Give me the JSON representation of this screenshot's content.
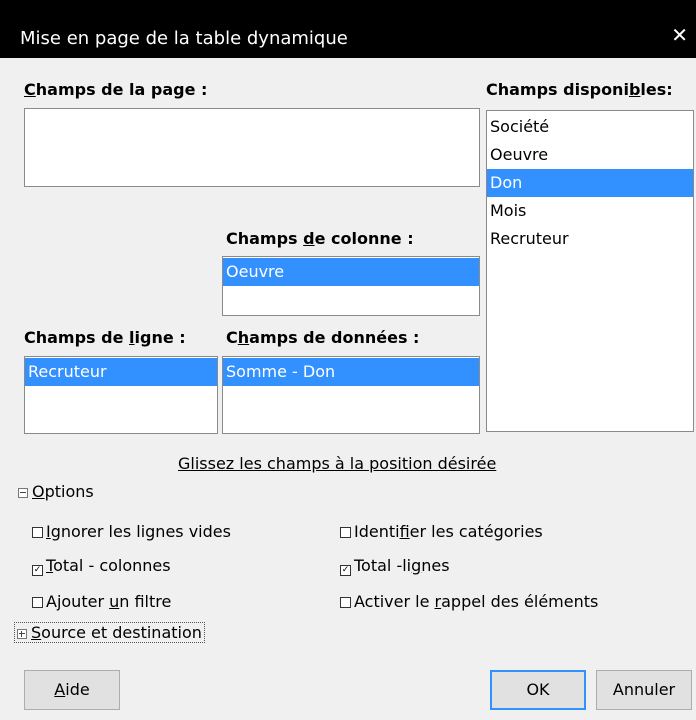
{
  "window": {
    "title": "Mise en page de la table dynamique",
    "close_glyph": "✕"
  },
  "page_fields": {
    "label": "Champs de la page :",
    "items": []
  },
  "available_fields": {
    "label": "Champs disponibles:",
    "items": [
      {
        "label": "Société",
        "selected": false
      },
      {
        "label": "Oeuvre",
        "selected": false
      },
      {
        "label": "Don",
        "selected": true
      },
      {
        "label": "Mois",
        "selected": false
      },
      {
        "label": "Recruteur",
        "selected": false
      }
    ]
  },
  "column_fields": {
    "label": "Champs de colonne :",
    "items": [
      {
        "label": "Oeuvre",
        "selected": true
      }
    ]
  },
  "row_fields": {
    "label": "Champs de ligne :",
    "items": [
      {
        "label": "Recruteur",
        "selected": true
      }
    ]
  },
  "data_fields": {
    "label": "Champs de données :",
    "items": [
      {
        "label": "Somme - Don",
        "selected": true
      }
    ]
  },
  "drag_hint": "Glissez les champs à la position désirée",
  "options": {
    "label": "Options",
    "expanded": true,
    "checkboxes": {
      "ignore_empty": {
        "label": "Ignorer les lignes vides",
        "checked": false
      },
      "identify_categories": {
        "label": "Identifier les catégories",
        "checked": false
      },
      "total_columns": {
        "label": "Total - colonnes",
        "checked": true
      },
      "total_rows": {
        "label": "Total -lignes",
        "checked": true
      },
      "add_filter": {
        "label": "Ajouter un filtre",
        "checked": false
      },
      "enable_drill": {
        "label": "Activer le rappel des éléments",
        "checked": false
      }
    }
  },
  "source_dest": {
    "label": "Source et destination",
    "expanded": false
  },
  "buttons": {
    "help": "Aide",
    "ok": "OK",
    "cancel": "Annuler"
  },
  "colors": {
    "selection": "#3390ff",
    "titlebar": "#000000",
    "dialog_bg": "#f0f0f0"
  }
}
